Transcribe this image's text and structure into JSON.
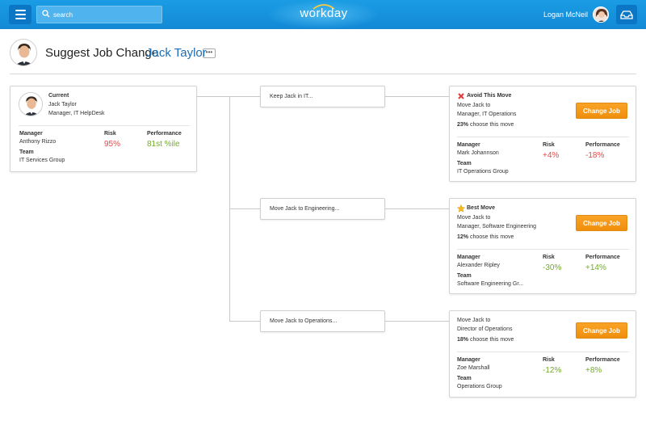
{
  "topbar": {
    "search_placeholder": "search",
    "logo_text": "workday",
    "user_name": "Logan McNeil"
  },
  "header": {
    "title": "Suggest Job Change",
    "person": "Jack Taylor",
    "more": "•••"
  },
  "current": {
    "heading": "Current",
    "name": "Jack Taylor",
    "position": "Manager, IT HelpDesk",
    "manager_label": "Manager",
    "manager": "Anthony Rizzo",
    "team_label": "Team",
    "team": "IT Services Group",
    "risk_label": "Risk",
    "risk": "95%",
    "performance_label": "Performance",
    "performance": "81st %ile"
  },
  "options": [
    {
      "label": "Keep Jack in IT..."
    },
    {
      "label": "Move Jack to Engineering..."
    },
    {
      "label": "Move Jack to Operations..."
    }
  ],
  "results": [
    {
      "badge": "Avoid This Move",
      "badge_icon": "x-mark-icon",
      "line1": "Move Jack to",
      "line2": "Manager, IT Operations",
      "pct": "23%",
      "pct_text": "choose this move",
      "button": "Change Job",
      "manager_label": "Manager",
      "manager": "Mark Johannson",
      "team_label": "Team",
      "team": "IT Operations Group",
      "risk_label": "Risk",
      "risk": "+4%",
      "performance_label": "Performance",
      "performance": "-18%"
    },
    {
      "badge": "Best Move",
      "badge_icon": "star-icon",
      "line1": "Move Jack to",
      "line2": "Manager, Software Engineering",
      "pct": "12%",
      "pct_text": "choose this move",
      "button": "Change Job",
      "manager_label": "Manager",
      "manager": "Alexander Ripley",
      "team_label": "Team",
      "team": "Software Engineering Gr...",
      "risk_label": "Risk",
      "risk": "-30%",
      "performance_label": "Performance",
      "performance": "+14%"
    },
    {
      "line1": "Move Jack to",
      "line2": "Director of Operations",
      "pct": "18%",
      "pct_text": "choose this move",
      "button": "Change Job",
      "manager_label": "Manager",
      "manager": "Zoe Marshall",
      "team_label": "Team",
      "team": "Operations Group",
      "risk_label": "Risk",
      "risk": "-12%",
      "performance_label": "Performance",
      "performance": "+8%"
    }
  ],
  "colors": {
    "topbar": "#1389d6",
    "link": "#1e6db3",
    "button": "#f39612",
    "negative": "#e34a4a",
    "positive": "#74a92e"
  }
}
